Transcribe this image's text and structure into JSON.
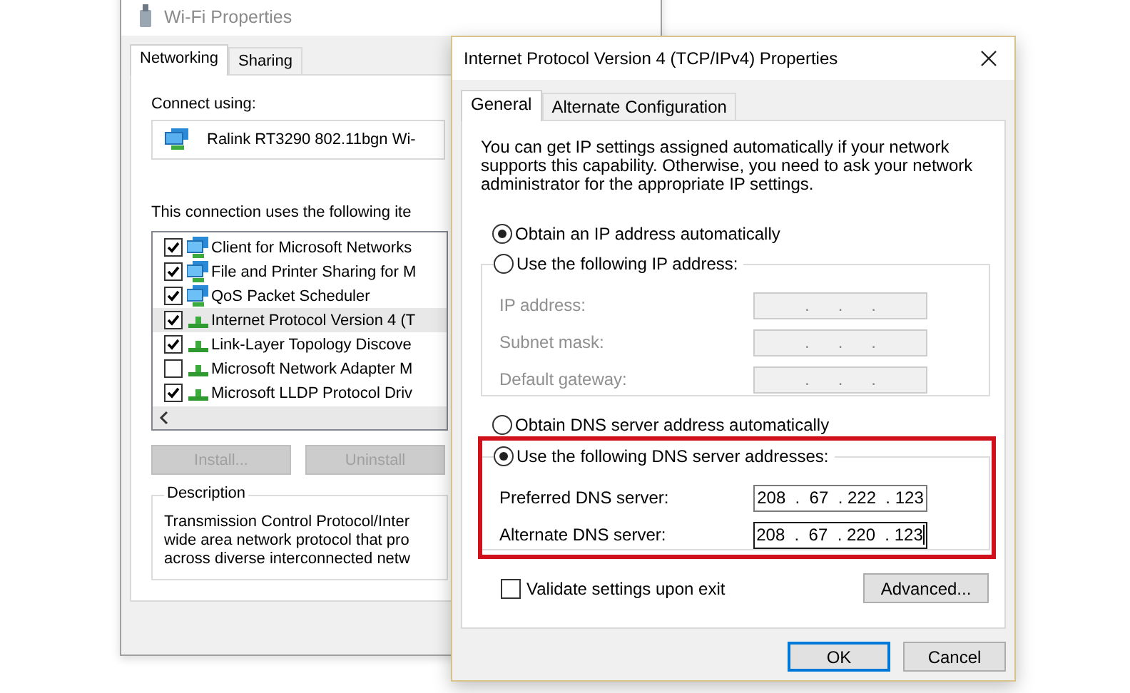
{
  "back_window": {
    "title": "Wi-Fi Properties",
    "tabs": [
      {
        "label": "Networking",
        "selected": true
      },
      {
        "label": "Sharing",
        "selected": false
      }
    ],
    "connect_label": "Connect using:",
    "adapter": "Ralink RT3290 802.11bgn Wi-",
    "items_label": "This connection uses the following ite",
    "items": [
      {
        "label": "Client for Microsoft Networks",
        "checked": true,
        "selected": false,
        "kind": "client"
      },
      {
        "label": "File and Printer Sharing for M",
        "checked": true,
        "selected": false,
        "kind": "client"
      },
      {
        "label": "QoS Packet Scheduler",
        "checked": true,
        "selected": false,
        "kind": "client"
      },
      {
        "label": "Internet Protocol Version 4 (T",
        "checked": true,
        "selected": true,
        "kind": "protocol"
      },
      {
        "label": "Link-Layer Topology Discove",
        "checked": true,
        "selected": false,
        "kind": "protocol"
      },
      {
        "label": "Microsoft Network Adapter M",
        "checked": false,
        "selected": false,
        "kind": "protocol"
      },
      {
        "label": "Microsoft LLDP Protocol Driv",
        "checked": true,
        "selected": false,
        "kind": "protocol"
      }
    ],
    "buttons": [
      {
        "label": "Install...",
        "disabled": true
      },
      {
        "label": "Uninstall",
        "disabled": true
      }
    ],
    "description": {
      "title": "Description",
      "lines": [
        "Transmission Control Protocol/Inter",
        "wide area network protocol that pro",
        "across diverse interconnected netw"
      ]
    }
  },
  "front_window": {
    "title": "Internet Protocol Version 4 (TCP/IPv4) Properties",
    "tabs": [
      {
        "label": "General",
        "selected": true
      },
      {
        "label": "Alternate Configuration",
        "selected": false
      }
    ],
    "intro": "You can get IP settings assigned automatically if your network supports this capability. Otherwise, you need to ask your network administrator for the appropriate IP settings.",
    "ip_modes": [
      {
        "label": "Obtain an IP address automatically",
        "selected": true
      },
      {
        "label": "Use the following IP address:",
        "selected": false
      }
    ],
    "ip_fields": [
      {
        "label": "IP address:",
        "value": ".      .      .",
        "disabled": true,
        "focused": false
      },
      {
        "label": "Subnet mask:",
        "value": ".      .      .",
        "disabled": true,
        "focused": false
      },
      {
        "label": "Default gateway:",
        "value": ".      .      .",
        "disabled": true,
        "focused": false
      }
    ],
    "dns_modes": [
      {
        "label": "Obtain DNS server address automatically",
        "selected": false
      },
      {
        "label": "Use the following DNS server addresses:",
        "selected": true
      }
    ],
    "dns_fields": [
      {
        "label": "Preferred DNS server:",
        "value": "208  .  67  . 222  . 123",
        "disabled": false,
        "focused": false
      },
      {
        "label": "Alternate DNS server:",
        "value": "208  .  67  . 220  . 123",
        "disabled": false,
        "focused": true
      }
    ],
    "validate": {
      "label": "Validate settings upon exit",
      "checked": false
    },
    "advanced_button": "Advanced...",
    "buttons": [
      {
        "label": "OK",
        "default": true
      },
      {
        "label": "Cancel",
        "default": false
      }
    ]
  }
}
